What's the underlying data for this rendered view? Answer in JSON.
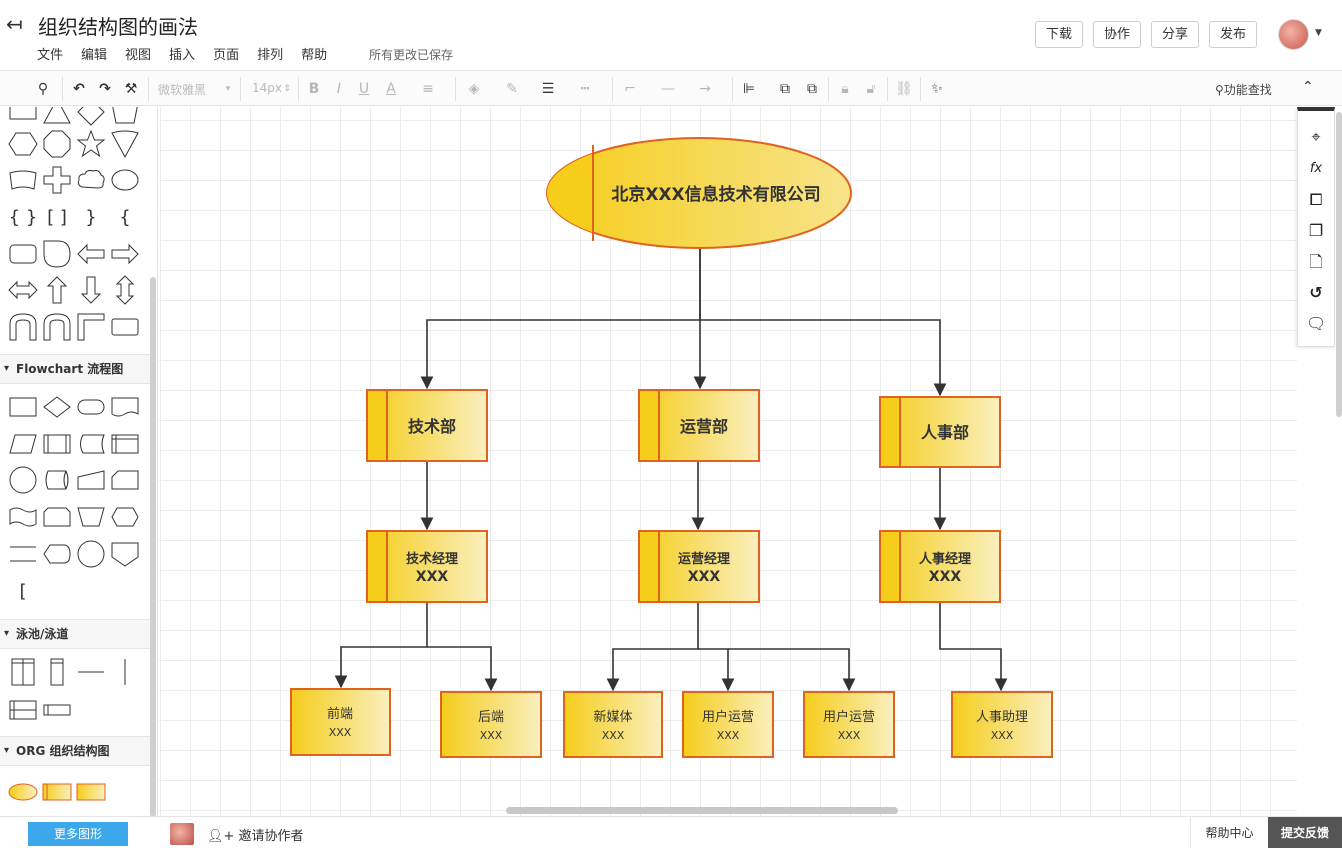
{
  "header": {
    "back_icon": "back-arrow-icon",
    "title": "组织结构图的画法",
    "menu": [
      "文件",
      "编辑",
      "视图",
      "插入",
      "页面",
      "排列",
      "帮助"
    ],
    "save_status": "所有更改已保存",
    "buttons": {
      "download": "下载",
      "collaborate": "协作",
      "share": "分享",
      "publish": "发布"
    }
  },
  "toolbar": {
    "font_name": "微软雅黑",
    "font_size": "14px",
    "func_search": "功能查找",
    "icons": [
      "format-brush-icon",
      "undo-icon",
      "redo-icon",
      "paint-format-icon",
      "bold-icon",
      "italic-icon",
      "underline-icon",
      "font-color-icon",
      "align-icon",
      "fill-color-icon",
      "line-color-icon",
      "line-width-icon",
      "line-style-icon",
      "connector-icon",
      "line-type-icon",
      "arrow-icon",
      "align-objects-icon",
      "bring-front-icon",
      "send-back-icon",
      "lock-icon",
      "unlock-icon",
      "link-icon",
      "magic-wand-icon",
      "collapse-icon"
    ]
  },
  "left_panel": {
    "sections": [
      {
        "id": "flowchart",
        "label": "Flowchart 流程图"
      },
      {
        "id": "pool",
        "label": "泳池/泳道"
      },
      {
        "id": "org",
        "label": "ORG 组织结构图"
      }
    ],
    "more_shapes": "更多图形"
  },
  "right_panel": {
    "icons": [
      "navigator-icon",
      "formula-icon",
      "page-setup-icon",
      "copy-page-icon",
      "page-icon",
      "history-icon",
      "comment-icon"
    ]
  },
  "bottom": {
    "invite": "邀请协作者",
    "help_center": "帮助中心",
    "feedback": "提交反馈"
  },
  "diagram": {
    "root": "北京XXX信息技术有限公司",
    "departments": [
      "技术部",
      "运营部",
      "人事部"
    ],
    "managers": [
      {
        "title": "技术经理",
        "name": "XXX"
      },
      {
        "title": "运营经理",
        "name": "XXX"
      },
      {
        "title": "人事经理",
        "name": "XXX"
      }
    ],
    "staff": [
      {
        "title": "前端",
        "name": "XXX"
      },
      {
        "title": "后端",
        "name": "XXX"
      },
      {
        "title": "新媒体",
        "name": "XXX"
      },
      {
        "title": "用户运营",
        "name": "XXX"
      },
      {
        "title": "用户运营",
        "name": "XXX"
      },
      {
        "title": "人事助理",
        "name": "XXX"
      }
    ],
    "colors": {
      "fill_start": "#f5cd1a",
      "fill_end": "#faefbf",
      "stroke": "#e0621f",
      "line": "#333333"
    }
  }
}
